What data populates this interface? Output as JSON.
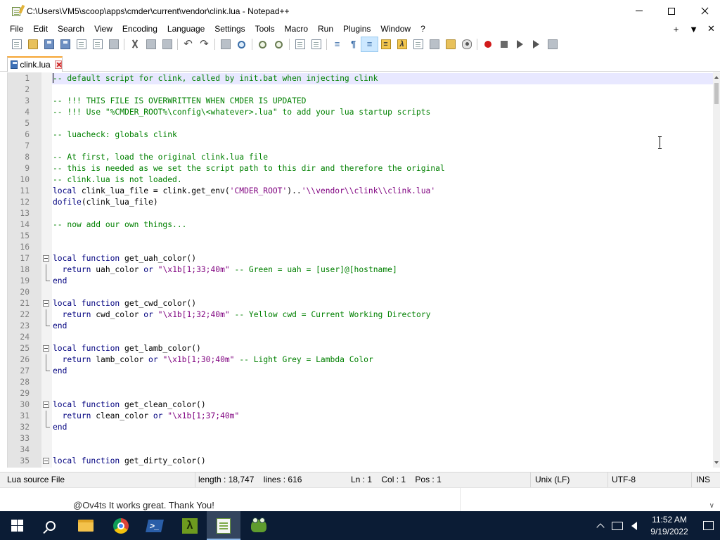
{
  "window": {
    "title": "C:\\Users\\VM5\\scoop\\apps\\cmder\\current\\vendor\\clink.lua - Notepad++",
    "app_icon": "notepadpp-icon",
    "controls": [
      "minimize-icon",
      "maximize-icon",
      "close-icon"
    ]
  },
  "menu": {
    "items": [
      "File",
      "Edit",
      "Search",
      "View",
      "Encoding",
      "Language",
      "Settings",
      "Tools",
      "Macro",
      "Run",
      "Plugins",
      "Window",
      "?"
    ],
    "right": [
      "+",
      "▼",
      "✕"
    ]
  },
  "tab": {
    "label": "clink.lua",
    "accent_color": "#f6a532"
  },
  "editor": {
    "language_colors": {
      "comment": "#008000",
      "keyword": "#00007f",
      "string": "#7f007f",
      "current_line": "#e8e8ff"
    },
    "lines": [
      {
        "n": "1",
        "tokens": [
          [
            "com",
            "-- default script for clink, called by init.bat when injecting clink"
          ]
        ],
        "current": true
      },
      {
        "n": "2",
        "tokens": []
      },
      {
        "n": "3",
        "tokens": [
          [
            "com",
            "-- !!! THIS FILE IS OVERWRITTEN WHEN CMDER IS UPDATED"
          ]
        ]
      },
      {
        "n": "4",
        "tokens": [
          [
            "com",
            "-- !!! Use \"%CMDER_ROOT%\\config\\<whatever>.lua\" to add your lua startup scripts"
          ]
        ]
      },
      {
        "n": "5",
        "tokens": []
      },
      {
        "n": "6",
        "tokens": [
          [
            "com",
            "-- luacheck: globals clink"
          ]
        ]
      },
      {
        "n": "7",
        "tokens": []
      },
      {
        "n": "8",
        "tokens": [
          [
            "com",
            "-- At first, load the original clink.lua file"
          ]
        ]
      },
      {
        "n": "9",
        "tokens": [
          [
            "com",
            "-- this is needed as we set the script path to this dir and therefore the original"
          ]
        ]
      },
      {
        "n": "10",
        "tokens": [
          [
            "com",
            "-- clink.lua is not loaded."
          ]
        ]
      },
      {
        "n": "11",
        "tokens": [
          [
            "kw",
            "local"
          ],
          [
            "id",
            " clink_lua_file = clink.get_env("
          ],
          [
            "str",
            "'CMDER_ROOT'"
          ],
          [
            "id",
            ").."
          ],
          [
            "str",
            "'\\\\vendor\\\\clink\\\\clink.lua'"
          ]
        ]
      },
      {
        "n": "12",
        "tokens": [
          [
            "kw",
            "dofile"
          ],
          [
            "id",
            "(clink_lua_file)"
          ]
        ]
      },
      {
        "n": "13",
        "tokens": []
      },
      {
        "n": "14",
        "tokens": [
          [
            "com",
            "-- now add our own things..."
          ]
        ]
      },
      {
        "n": "15",
        "tokens": []
      },
      {
        "n": "16",
        "tokens": []
      },
      {
        "n": "17",
        "fold": "start",
        "tokens": [
          [
            "kw",
            "local function"
          ],
          [
            "id",
            " get_uah_color()"
          ]
        ]
      },
      {
        "n": "18",
        "fold": "mid",
        "tokens": [
          [
            "id",
            "  "
          ],
          [
            "kw",
            "return"
          ],
          [
            "id",
            " uah_color "
          ],
          [
            "kw",
            "or"
          ],
          [
            "id",
            " "
          ],
          [
            "str",
            "\"\\x1b[1;33;40m\""
          ],
          [
            "id",
            " "
          ],
          [
            "com",
            "-- Green = uah = [user]@[hostname]"
          ]
        ]
      },
      {
        "n": "19",
        "fold": "end",
        "tokens": [
          [
            "kw",
            "end"
          ]
        ]
      },
      {
        "n": "20",
        "tokens": []
      },
      {
        "n": "21",
        "fold": "start",
        "tokens": [
          [
            "kw",
            "local function"
          ],
          [
            "id",
            " get_cwd_color()"
          ]
        ]
      },
      {
        "n": "22",
        "fold": "mid",
        "tokens": [
          [
            "id",
            "  "
          ],
          [
            "kw",
            "return"
          ],
          [
            "id",
            " cwd_color "
          ],
          [
            "kw",
            "or"
          ],
          [
            "id",
            " "
          ],
          [
            "str",
            "\"\\x1b[1;32;40m\""
          ],
          [
            "id",
            " "
          ],
          [
            "com",
            "-- Yellow cwd = Current Working Directory"
          ]
        ]
      },
      {
        "n": "23",
        "fold": "end",
        "tokens": [
          [
            "kw",
            "end"
          ]
        ]
      },
      {
        "n": "24",
        "tokens": []
      },
      {
        "n": "25",
        "fold": "start",
        "tokens": [
          [
            "kw",
            "local function"
          ],
          [
            "id",
            " get_lamb_color()"
          ]
        ]
      },
      {
        "n": "26",
        "fold": "mid",
        "tokens": [
          [
            "id",
            "  "
          ],
          [
            "kw",
            "return"
          ],
          [
            "id",
            " lamb_color "
          ],
          [
            "kw",
            "or"
          ],
          [
            "id",
            " "
          ],
          [
            "str",
            "\"\\x1b[1;30;40m\""
          ],
          [
            "id",
            " "
          ],
          [
            "com",
            "-- Light Grey = Lambda Color"
          ]
        ]
      },
      {
        "n": "27",
        "fold": "end",
        "tokens": [
          [
            "kw",
            "end"
          ]
        ]
      },
      {
        "n": "28",
        "tokens": []
      },
      {
        "n": "29",
        "tokens": []
      },
      {
        "n": "30",
        "fold": "start",
        "tokens": [
          [
            "kw",
            "local function"
          ],
          [
            "id",
            " get_clean_color()"
          ]
        ]
      },
      {
        "n": "31",
        "fold": "mid",
        "tokens": [
          [
            "id",
            "  "
          ],
          [
            "kw",
            "return"
          ],
          [
            "id",
            " clean_color "
          ],
          [
            "kw",
            "or"
          ],
          [
            "id",
            " "
          ],
          [
            "str",
            "\"\\x1b[1;37;40m\""
          ]
        ]
      },
      {
        "n": "32",
        "fold": "end",
        "tokens": [
          [
            "kw",
            "end"
          ]
        ]
      },
      {
        "n": "33",
        "tokens": []
      },
      {
        "n": "34",
        "tokens": []
      },
      {
        "n": "35",
        "fold": "start",
        "tokens": [
          [
            "kw",
            "local function"
          ],
          [
            "id",
            " get_dirty_color()"
          ]
        ]
      }
    ]
  },
  "statusbar": {
    "language": "Lua source File",
    "length": "length : 18,747",
    "lines": "lines : 616",
    "ln": "Ln : 1",
    "col": "Col : 1",
    "pos": "Pos : 1",
    "eol": "Unix (LF)",
    "encoding": "UTF-8",
    "mode": "INS"
  },
  "comment_strip": {
    "handle": "@Ov4ts",
    "text": " It works great. Thank You!",
    "chevron": "∨"
  },
  "taskbar": {
    "apps": [
      "windows-start-icon",
      "search-icon",
      "file-explorer-icon",
      "chrome-icon",
      "powershell-icon",
      "cmder-icon",
      "notepadpp-icon",
      "frog-app-icon"
    ],
    "powershell_glyph": ">_",
    "cmder_glyph": "λ",
    "clock_time": "11:52 AM",
    "clock_date": "9/19/2022"
  }
}
